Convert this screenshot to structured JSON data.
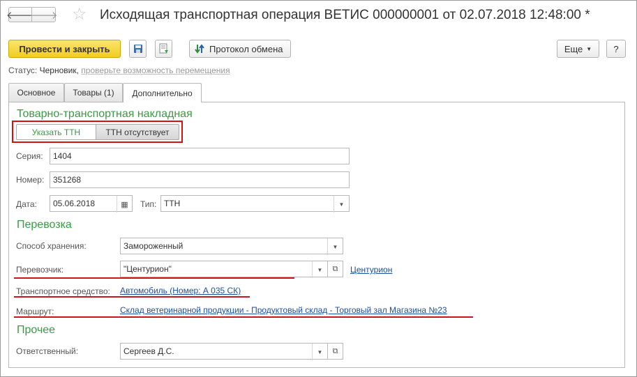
{
  "window": {
    "title": "Исходящая транспортная операция ВЕТИС 000000001 от 02.07.2018 12:48:00 *",
    "back_icon": "arrow-left",
    "forward_icon": "arrow-right",
    "favorite_icon": "star"
  },
  "toolbar": {
    "post_close_label": "Провести и закрыть",
    "exchange_label": "Протокол обмена",
    "more_label": "Еще",
    "help_label": "?"
  },
  "status": {
    "label": "Статус:",
    "value": "Черновик,",
    "hint": "проверьте возможность перемещения"
  },
  "tabs": [
    {
      "label": "Основное"
    },
    {
      "label": "Товары (1)"
    },
    {
      "label": "Дополнительно",
      "active": true
    }
  ],
  "ttn": {
    "section_title": "Товарно-транспортная накладная",
    "toggle_specify": "Указать ТТН",
    "toggle_absent": "ТТН отсутствует",
    "series_label": "Серия:",
    "series_value": "1404",
    "number_label": "Номер:",
    "number_value": "351268",
    "date_label": "Дата:",
    "date_value": "05.06.2018",
    "type_label": "Тип:",
    "type_value": "ТТН"
  },
  "transport": {
    "section_title": "Перевозка",
    "storage_label": "Способ хранения:",
    "storage_value": "Замороженный",
    "carrier_label": "Перевозчик:",
    "carrier_value": "\"Центурион\"",
    "carrier_link": "Центурион",
    "vehicle_label": "Транспортное средство:",
    "vehicle_link": "Автомобиль (Номер: А 035 СК)",
    "route_label": "Маршрут:",
    "route_link": "Склад ветеринарной продукции - Продуктовый склад - Торговый зал Магазина №23"
  },
  "other": {
    "section_title": "Прочее",
    "responsible_label": "Ответственный:",
    "responsible_value": "Сергеев Д.С."
  },
  "colors": {
    "section": "#3a9a45",
    "link": "#1b4f9c",
    "highlight": "#d41111",
    "primary_button": "#f2cd21"
  }
}
